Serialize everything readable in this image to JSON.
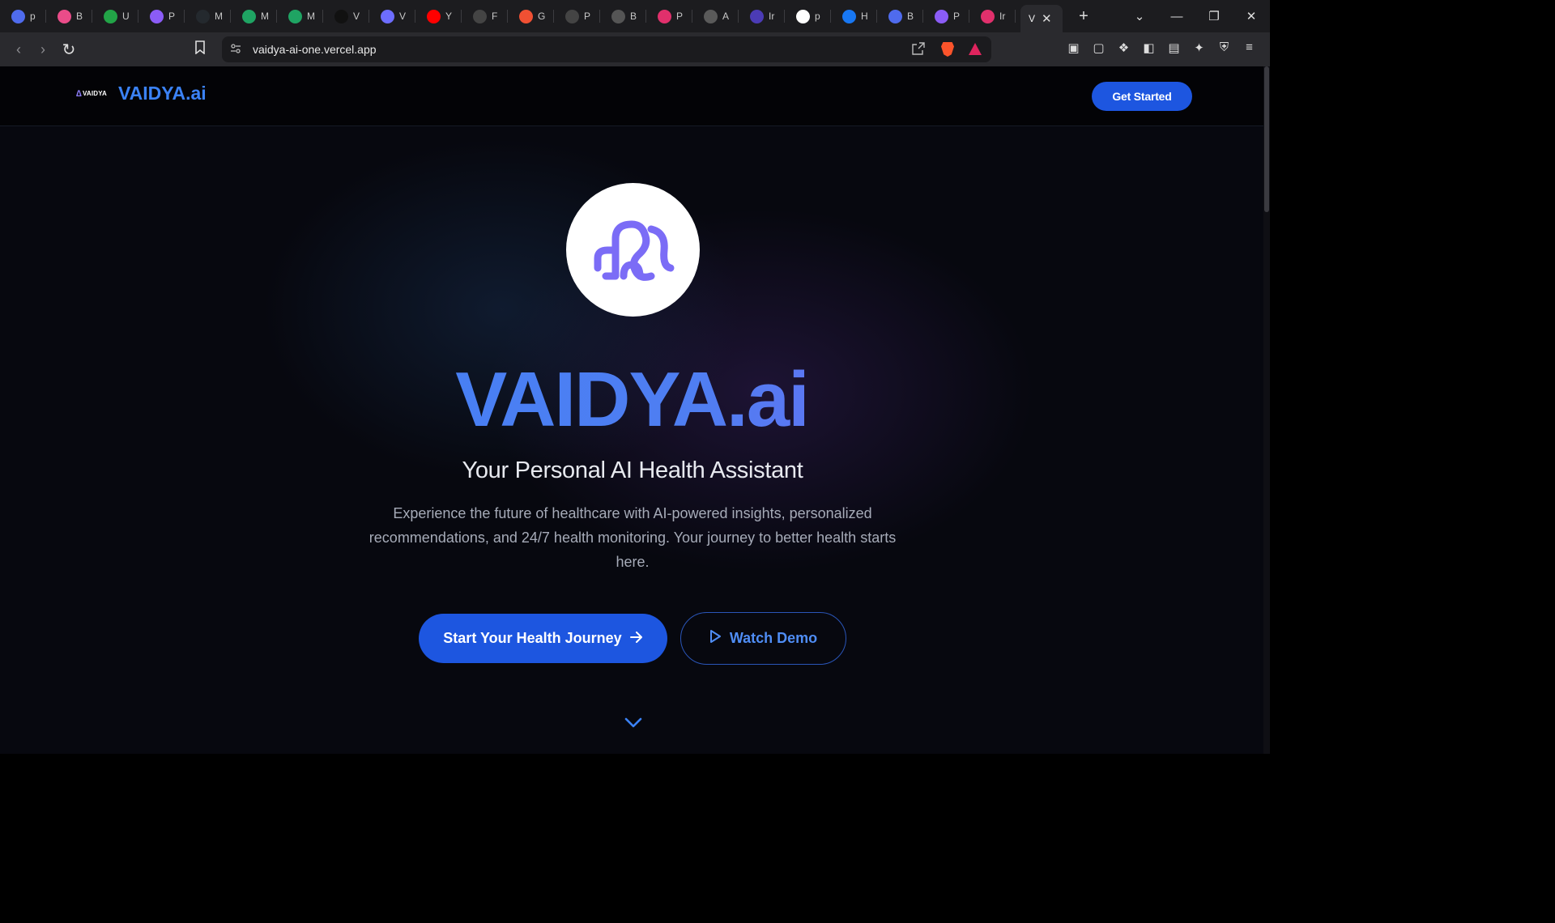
{
  "browser": {
    "tabs": [
      {
        "icon": "messages-icon",
        "label": "p",
        "color": "#4f6bed"
      },
      {
        "icon": "dribbble-icon",
        "label": "B",
        "color": "#ea4c89"
      },
      {
        "icon": "plus-square-icon",
        "label": "U",
        "color": "#22a447"
      },
      {
        "icon": "chatgpt-icon",
        "label": "P",
        "color": "#8b5cf6"
      },
      {
        "icon": "github-icon",
        "label": "M",
        "color": "#24292e"
      },
      {
        "icon": "drive-icon",
        "label": "M",
        "color": "#1fa463"
      },
      {
        "icon": "drive-icon",
        "label": "M",
        "color": "#1fa463"
      },
      {
        "icon": "vercel-icon",
        "label": "V",
        "color": "#111111"
      },
      {
        "icon": "app-icon",
        "label": "V",
        "color": "#6d6dff"
      },
      {
        "icon": "youtube-icon",
        "label": "Y",
        "color": "#ff0000"
      },
      {
        "icon": "openai-icon",
        "label": "F",
        "color": "#444444"
      },
      {
        "icon": "git-icon",
        "label": "G",
        "color": "#f05033"
      },
      {
        "icon": "openai-icon",
        "label": "P",
        "color": "#444444"
      },
      {
        "icon": "globe-icon",
        "label": "B",
        "color": "#555555"
      },
      {
        "icon": "instagram-icon",
        "label": "P",
        "color": "#e1306c"
      },
      {
        "icon": "app-icon",
        "label": "A",
        "color": "#5a5a5a"
      },
      {
        "icon": "app-icon",
        "label": "Ir",
        "color": "#4b3bb5"
      },
      {
        "icon": "six-icon",
        "label": "p",
        "color": "#ffffff"
      },
      {
        "icon": "c-icon",
        "label": "H",
        "color": "#1877f2"
      },
      {
        "icon": "messages-icon",
        "label": "B",
        "color": "#4f6bed"
      },
      {
        "icon": "chatgpt-icon",
        "label": "P",
        "color": "#8b5cf6"
      },
      {
        "icon": "instagram-icon",
        "label": "Ir",
        "color": "#e1306c"
      }
    ],
    "active_tab": {
      "label": "V",
      "close": "✕"
    },
    "new_tab": "+",
    "tab_menu": "⌄",
    "window": {
      "minimize": "—",
      "restore": "❐",
      "close": "✕"
    },
    "url": "vaidya-ai-one.vercel.app"
  },
  "nav": {
    "logo_text": "VAIDYA",
    "brand": "VAIDYA.ai",
    "cta": "Get Started"
  },
  "hero": {
    "title": "VAIDYA.ai",
    "subtitle": "Your Personal AI Health Assistant",
    "description": "Experience the future of healthcare with AI-powered insights, personalized recommendations, and 24/7 health monitoring. Your journey to better health starts here.",
    "primary_button": "Start Your Health Journey",
    "secondary_button": "Watch Demo"
  },
  "colors": {
    "accent": "#3b82f6",
    "button_bg": "#1d56e0",
    "logo_purple": "#7b6cf6",
    "page_bg": "#07080f"
  }
}
